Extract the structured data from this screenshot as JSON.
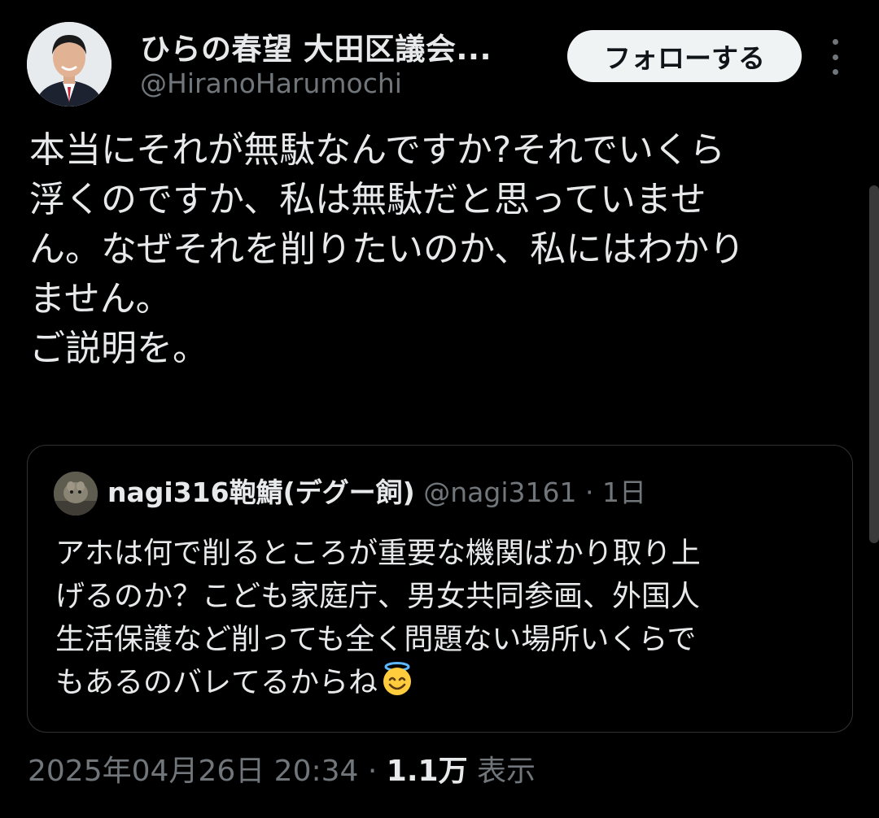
{
  "author": {
    "display_name": "ひらの春望 大田区議会...",
    "handle": "@HiranoHarumochi"
  },
  "follow_button": {
    "label": "フォローする"
  },
  "more_icon": "more-vertical-icon",
  "tweet": {
    "lines": [
      "本当にそれが無駄なんですか?それでいくら",
      "浮くのですか、私は無駄だと思っていませ",
      "ん。なぜそれを削りたいのか、私にはわかり",
      "ません。",
      "ご説明を。"
    ]
  },
  "quote": {
    "author_name": "nagi316鞄鯖(デグー飼)",
    "handle": "@nagi3161",
    "separator": "·",
    "time": "1日",
    "lines": [
      "アホは何で削るところが重要な機関ばかり取り上",
      "げるのか？こども家庭庁、男女共同参画、外国人",
      "生活保護など削っても全く問題ない場所いくらで",
      "もあるのバレてるからね"
    ],
    "emoji": "smiling-face-with-halo"
  },
  "meta": {
    "datetime": "2025年04月26日 20:34",
    "separator": "·",
    "views_count": "1.1万",
    "views_label": "表示"
  },
  "colors": {
    "background": "#000000",
    "primary_text": "#e7e9ea",
    "secondary_text": "#71767b",
    "border": "#2f3336",
    "button_bg": "#eff3f4"
  }
}
